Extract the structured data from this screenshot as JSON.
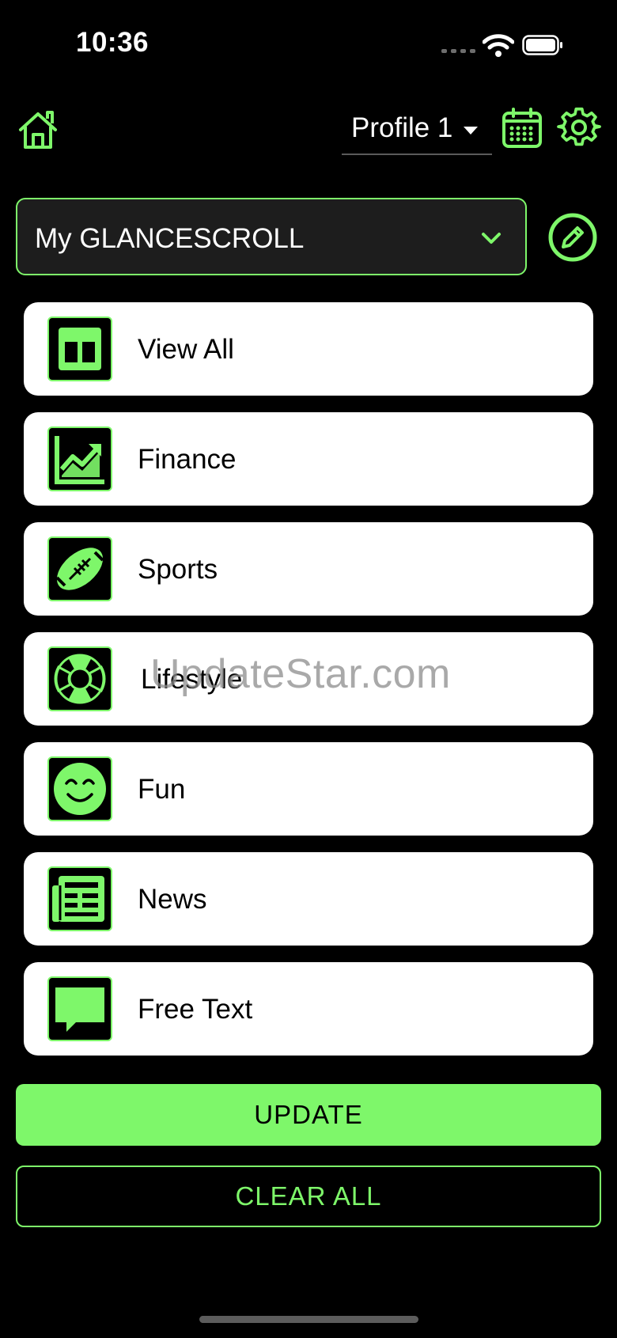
{
  "status_bar": {
    "time": "10:36"
  },
  "header": {
    "profile_label": "Profile 1"
  },
  "selector": {
    "value": "My GLANCESCROLL"
  },
  "list": {
    "items": [
      {
        "label": "View All",
        "icon": "view-all-icon"
      },
      {
        "label": "Finance",
        "icon": "finance-chart-icon"
      },
      {
        "label": "Sports",
        "icon": "football-icon"
      },
      {
        "label": "Lifestyle",
        "icon": "lifebuoy-icon"
      },
      {
        "label": "Fun",
        "icon": "smiley-icon"
      },
      {
        "label": "News",
        "icon": "newspaper-icon"
      },
      {
        "label": "Free Text",
        "icon": "chat-bubble-icon"
      }
    ]
  },
  "buttons": {
    "update": "UPDATE",
    "clear_all": "CLEAR ALL"
  },
  "watermark": "UpdateStar.com",
  "colors": {
    "accent": "#7ef76a",
    "background": "#000000",
    "card": "#ffffff"
  }
}
